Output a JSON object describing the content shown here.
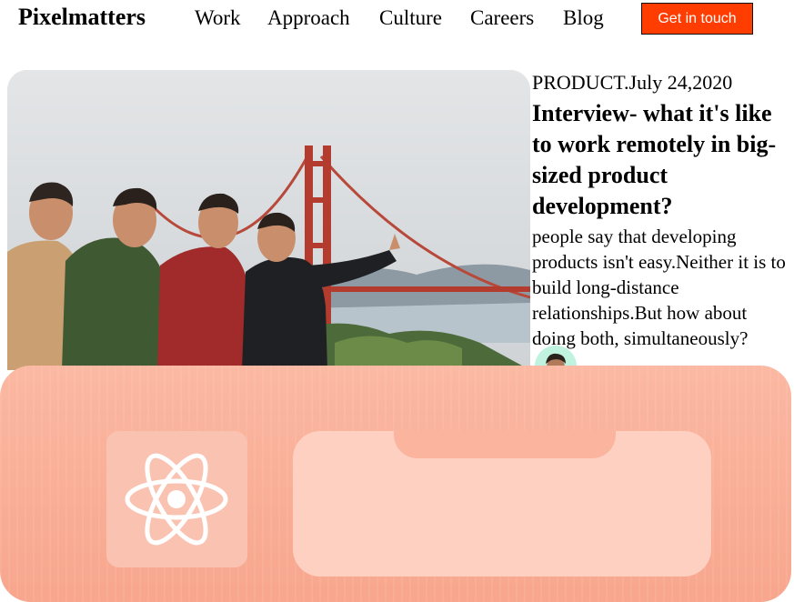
{
  "brand": "Pixelmatters",
  "nav": {
    "items": [
      "Work",
      "Approach",
      "Culture",
      "Careers",
      "Blog"
    ],
    "cta_label": "Get in touch"
  },
  "article": {
    "meta": "PRODUCT.July 24,2020",
    "title": "Interview- what it's like to work remotely in big- sized product development?",
    "excerpt": "people say that developing products isn't easy.Neither it is to build long-distance relationships.But how about doing both, simultaneously?"
  },
  "icons": {
    "card2": "react-logo-icon"
  },
  "colors": {
    "cta": "#ff3d00",
    "card2": "#f8a68d"
  }
}
